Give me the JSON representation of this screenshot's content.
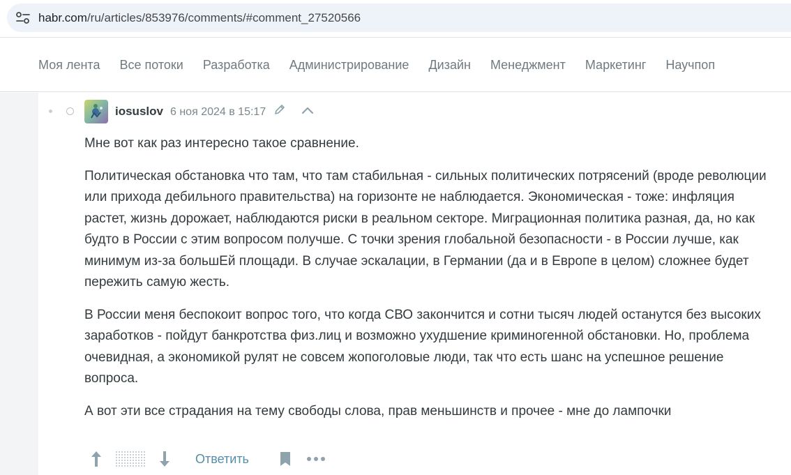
{
  "browser": {
    "url_host": "habr.com",
    "url_path": "/ru/articles/853976/comments/#comment_27520566"
  },
  "nav": {
    "items": [
      {
        "label": "Моя лента"
      },
      {
        "label": "Все потоки"
      },
      {
        "label": "Разработка"
      },
      {
        "label": "Администрирование"
      },
      {
        "label": "Дизайн"
      },
      {
        "label": "Менеджмент"
      },
      {
        "label": "Маркетинг"
      },
      {
        "label": "Научпоп"
      }
    ]
  },
  "comment": {
    "author": "iosuslov",
    "timestamp": "6 ноя 2024 в 15:17",
    "paragraphs": [
      "Мне вот как раз интересно такое сравнение.",
      "Политическая обстановка что там, что там стабильная - сильных политических потрясений (вроде революции или прихода дебильного правительства) на горизонте не наблюдается. Экономическая - тоже: инфляция растет, жизнь дорожает, наблюдаются риски в реальном секторе. Миграционная политика разная, да, но как будто в России с этим вопросом получше. С точки зрения глобальной безопасности - в России лучше, как минимум из-за большЕй площади. В случае эскалации, в Германии (да и в Европе в целом) сложнее будет пережить самую жесть.",
      "В России меня беспокоит вопрос того, что когда СВО закончится и сотни тысяч людей останутся без высоких заработков - пойдут банкротства физ.лиц и возможно ухудшение криминогенной обстановки. Но, проблема очевидная, а экономикой рулят не совсем жопоголовые люди, так что есть шанс на успешное решение вопроса.",
      "А вот эти все страдания на тему свободы слова, прав меньшинств и прочее - мне до лампочки"
    ],
    "actions": {
      "reply_label": "Ответить"
    }
  },
  "icons": {
    "site_settings": "tune-icon",
    "edit": "pencil-icon",
    "collapse": "chevron-up-icon",
    "vote_up": "arrow-up-icon",
    "vote_down": "arrow-down-icon",
    "bookmark": "bookmark-icon",
    "more": "more-dots-icon"
  },
  "colors": {
    "link": "#548eaa",
    "text": "#333b3f",
    "muted": "#7b868c",
    "icon": "#8fa3ad"
  }
}
